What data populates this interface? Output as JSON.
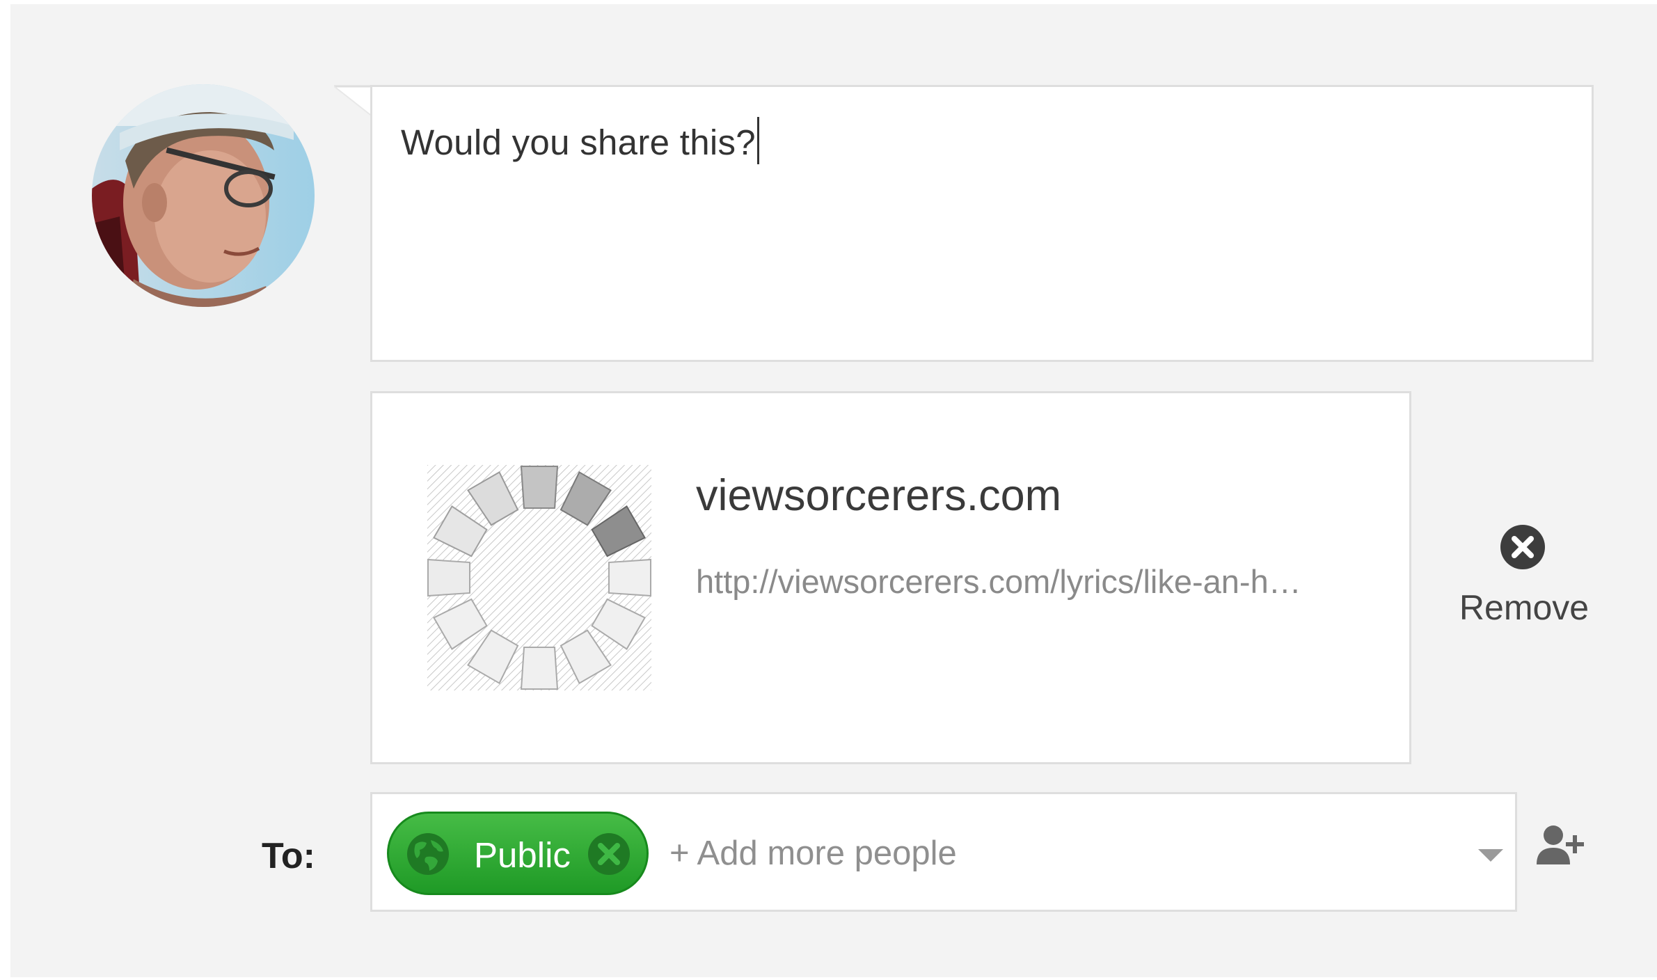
{
  "composer": {
    "text": "Would you share this?"
  },
  "link_preview": {
    "domain": "viewsorcerers.com",
    "url": "http://viewsorcerers.com/lyrics/like-an-h…",
    "thumbnail_icon": "loading-spinner-icon",
    "remove_label": "Remove",
    "remove_icon": "remove-circle-icon"
  },
  "audience": {
    "to_label": "To:",
    "chip_label": "Public",
    "chip_icon": "globe-icon",
    "chip_remove_icon": "close-circle-icon",
    "add_more_placeholder": "+ Add more people",
    "dropdown_icon": "chevron-down-icon",
    "add_person_icon": "add-person-icon"
  },
  "colors": {
    "background": "#f3f3f3",
    "card": "#ffffff",
    "border": "#dedede",
    "public_chip": "#2ea836",
    "muted_text": "#8a8a8a"
  }
}
